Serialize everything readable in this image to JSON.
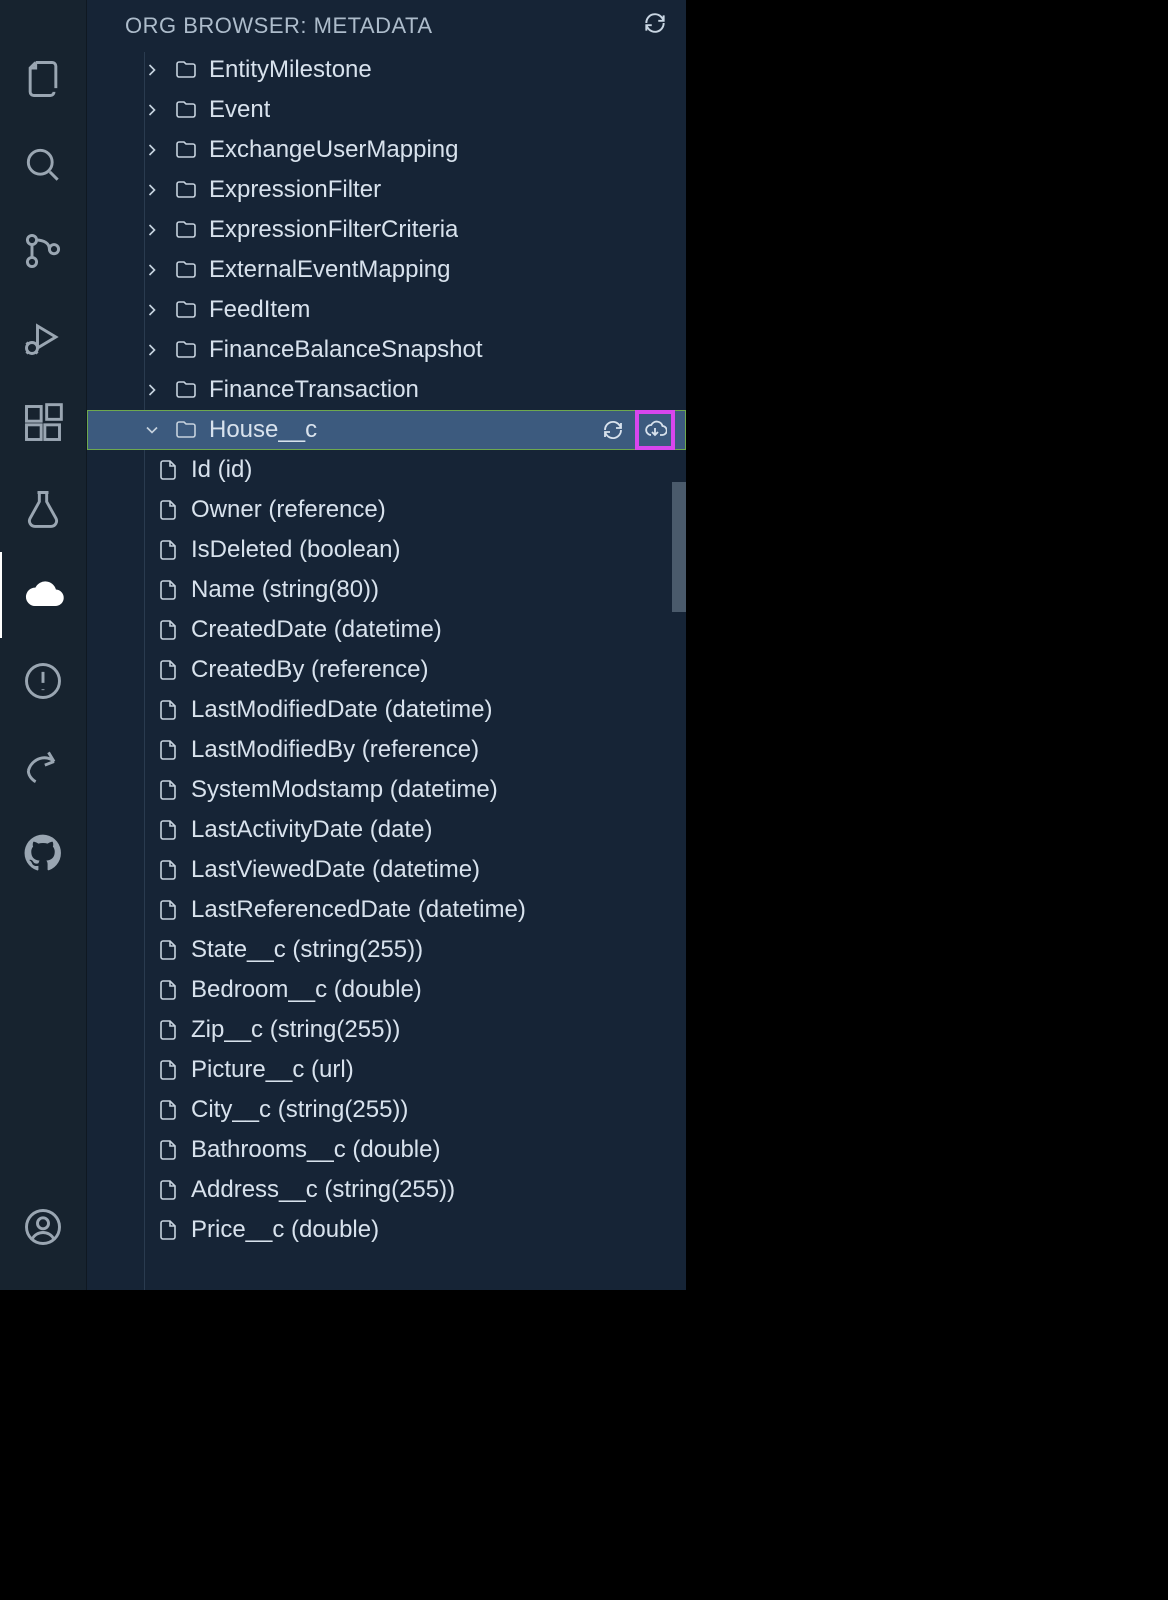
{
  "sidebar": {
    "title": "ORG BROWSER: METADATA"
  },
  "tree": {
    "folders": [
      {
        "label": "EntityMilestone",
        "expanded": false
      },
      {
        "label": "Event",
        "expanded": false
      },
      {
        "label": "ExchangeUserMapping",
        "expanded": false
      },
      {
        "label": "ExpressionFilter",
        "expanded": false
      },
      {
        "label": "ExpressionFilterCriteria",
        "expanded": false
      },
      {
        "label": "ExternalEventMapping",
        "expanded": false
      },
      {
        "label": "FeedItem",
        "expanded": false
      },
      {
        "label": "FinanceBalanceSnapshot",
        "expanded": false
      },
      {
        "label": "FinanceTransaction",
        "expanded": false
      },
      {
        "label": "House__c",
        "expanded": true,
        "selected": true
      }
    ],
    "fields": [
      {
        "label": "Id (id)"
      },
      {
        "label": "Owner (reference)"
      },
      {
        "label": "IsDeleted (boolean)"
      },
      {
        "label": "Name (string(80))"
      },
      {
        "label": "CreatedDate (datetime)"
      },
      {
        "label": "CreatedBy (reference)"
      },
      {
        "label": "LastModifiedDate (datetime)"
      },
      {
        "label": "LastModifiedBy (reference)"
      },
      {
        "label": "SystemModstamp (datetime)"
      },
      {
        "label": "LastActivityDate (date)"
      },
      {
        "label": "LastViewedDate (datetime)"
      },
      {
        "label": "LastReferencedDate (datetime)"
      },
      {
        "label": "State__c (string(255))"
      },
      {
        "label": "Bedroom__c (double)"
      },
      {
        "label": "Zip__c (string(255))"
      },
      {
        "label": "Picture__c (url)"
      },
      {
        "label": "City__c (string(255))"
      },
      {
        "label": "Bathrooms__c (double)"
      },
      {
        "label": "Address__c (string(255))"
      },
      {
        "label": "Price__c (double)"
      }
    ]
  },
  "colors": {
    "highlight": "#d946ef",
    "select_bg": "#3c5a7e",
    "select_outline": "#6ea84f",
    "bg_sidebar": "#162436",
    "bg_activity": "#17232f"
  }
}
